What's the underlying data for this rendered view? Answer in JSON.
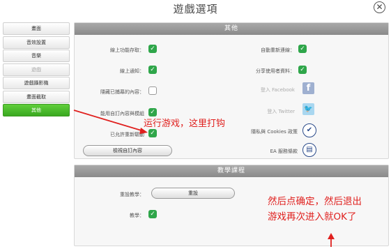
{
  "window": {
    "title": "遊戲選項"
  },
  "sidebar": {
    "items": [
      {
        "label": "畫面"
      },
      {
        "label": "音效設置"
      },
      {
        "label": "音樂"
      },
      {
        "label": "遊戲"
      },
      {
        "label": "遊戲攝影機"
      },
      {
        "label": "畫面截取"
      },
      {
        "label": "其他"
      }
    ]
  },
  "other_section": {
    "header": "其他",
    "online_features": {
      "label": "線上功能存取：",
      "checked": true
    },
    "online_notify": {
      "label": "線上通知：",
      "checked": true
    },
    "hide_purchased": {
      "label": "隱藏已捕幕的內容：",
      "checked": false
    },
    "disable_custom": {
      "label": "能用自訂內容與模組",
      "checked": true
    },
    "allow_redrive": {
      "label": "已允許重新驅動",
      "checked": true
    },
    "view_custom_button": "檢視自訂內容",
    "auto_reconnect": {
      "label": "自動重新連線：",
      "checked": true
    },
    "share_usage": {
      "label": "分享使用者資料：",
      "checked": true
    },
    "facebook_login": "登入 Facebook",
    "twitter_login": "登入 Twitter",
    "privacy_cookies": "隱私與 Cookies 政策",
    "ea_terms": "EA 服務條款"
  },
  "tutorial_section": {
    "header": "教學課程",
    "reset_tutorial_label": "重設教學：",
    "reset_button": "重設",
    "tutorial": {
      "label": "教學：",
      "checked": true
    }
  },
  "annotations": {
    "note_1": "运行游戏，这里打钩",
    "note_2_line_1": "然后点确定，然后退出",
    "note_2_line_2": "游戏再次进入就OK了"
  },
  "colors": {
    "active_green": "#3aa820",
    "check_green": "#2fa64a",
    "annotation_red": "#e0201e"
  }
}
